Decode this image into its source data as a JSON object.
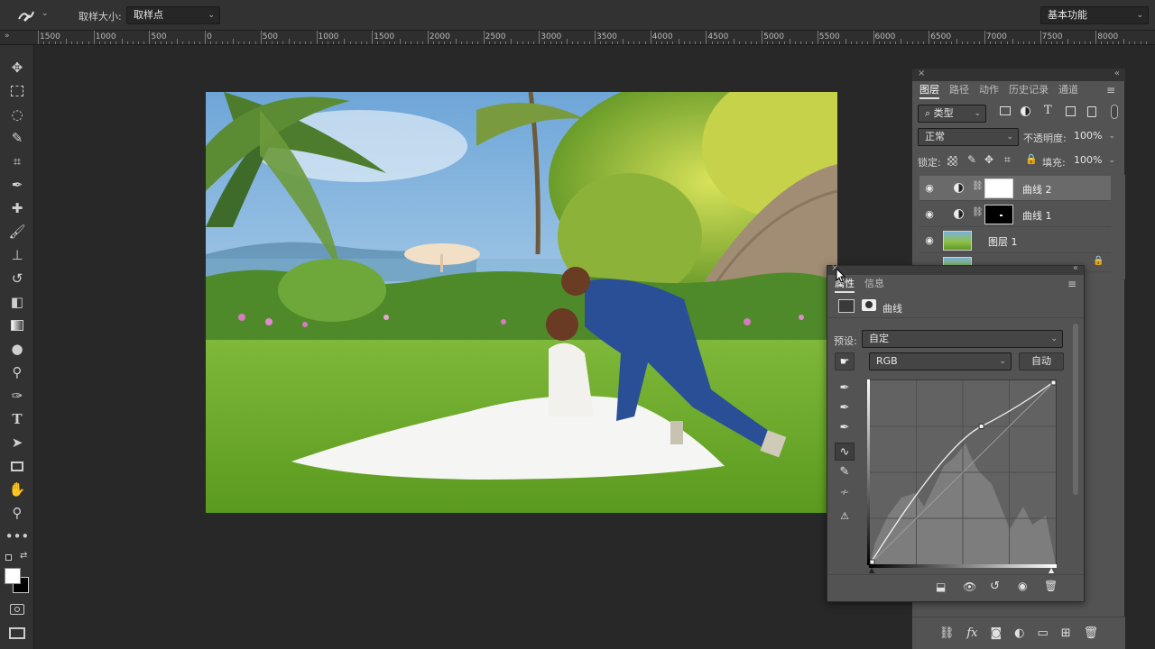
{
  "options_bar": {
    "tool_icon": "eyedropper-curves-icon",
    "sample_size_label": "取样大小:",
    "sample_size_value": "取样点",
    "workspace_value": "基本功能"
  },
  "ruler": {
    "labels": [
      "1500",
      "1000",
      "500",
      "0",
      "500",
      "1000",
      "1500",
      "2000",
      "2500",
      "3000",
      "3500",
      "4000",
      "4500",
      "5000",
      "5500",
      "6000",
      "6500",
      "7000",
      "7500",
      "8000"
    ]
  },
  "toolbar": {
    "tools": [
      "move-icon",
      "marquee-icon",
      "lasso-icon",
      "quick-select-icon",
      "crop-icon",
      "eyedropper-icon",
      "healing-icon",
      "brush-icon",
      "stamp-icon",
      "history-brush-icon",
      "eraser-icon",
      "gradient-icon",
      "blur-icon",
      "dodge-icon",
      "pen-icon",
      "type-icon",
      "path-select-icon",
      "rectangle-icon",
      "hand-icon",
      "zoom-icon",
      "more-icon"
    ]
  },
  "layers_panel": {
    "tabs": [
      "图层",
      "路径",
      "动作",
      "历史记录",
      "通道"
    ],
    "filter_label": "类型",
    "blend_mode": "正常",
    "opacity_label": "不透明度:",
    "opacity_value": "100%",
    "lock_label": "锁定:",
    "fill_label": "填充:",
    "fill_value": "100%",
    "layers": [
      {
        "name": "曲线 2",
        "type": "curves",
        "selected": true
      },
      {
        "name": "曲线 1",
        "type": "curves",
        "selected": false
      },
      {
        "name": "图层 1",
        "type": "pixel",
        "selected": false
      }
    ]
  },
  "properties_panel": {
    "tabs": [
      "属性",
      "信息"
    ],
    "adjustment_title": "曲线",
    "preset_label": "预设:",
    "preset_value": "自定",
    "channel_value": "RGB",
    "auto_button": "自动",
    "curve_points": [
      [
        0,
        0
      ],
      [
        0.6,
        0.75
      ],
      [
        1,
        1
      ]
    ]
  },
  "colors": {
    "panel_bg": "#535353",
    "app_bg": "#282828",
    "bar_bg": "#323232"
  }
}
